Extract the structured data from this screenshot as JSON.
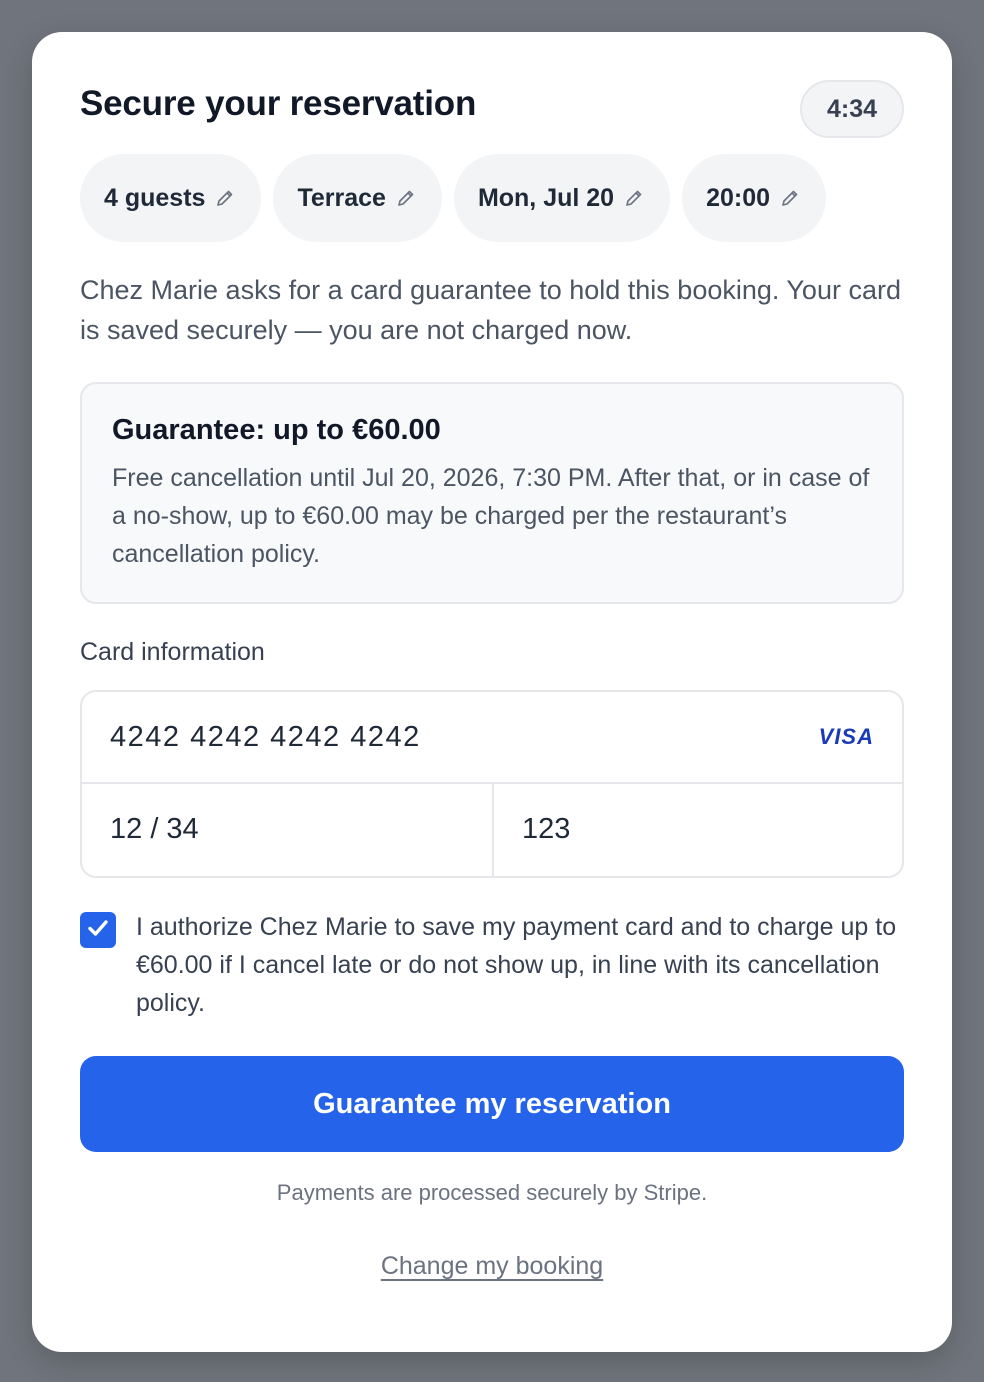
{
  "header": {
    "title": "Secure your reservation",
    "timer": "4:34"
  },
  "chips": [
    {
      "label": "4 guests",
      "icon": "pencil-icon"
    },
    {
      "label": "Terrace",
      "icon": "pencil-icon"
    },
    {
      "label": "Mon, Jul 20",
      "icon": "pencil-icon"
    },
    {
      "label": "20:00",
      "icon": "pencil-icon"
    }
  ],
  "intro": "Chez Marie asks for a card guarantee to hold this booking. Your card is saved securely — you are not charged now.",
  "guarantee": {
    "title": "Guarantee: up to €60.00",
    "text": "Free cancellation until Jul 20, 2026, 7:30 PM. After that, or in case of a no-show, up to €60.00 may be charged per the restaurant’s cancellation policy."
  },
  "card": {
    "label": "Card information",
    "number": "4242 4242 4242 4242",
    "brand": "VISA",
    "expiry": "12 / 34",
    "cvc": "123"
  },
  "consent": {
    "checked": true,
    "text": "I authorize Chez Marie to save my payment card and to charge up to €60.00 if I cancel late or do not show up, in line with its cancellation policy."
  },
  "actions": {
    "primary_label": "Guarantee my reservation",
    "stripe_note": "Payments are processed securely by Stripe.",
    "change_link": "Change my booking"
  },
  "colors": {
    "accent": "#2563eb",
    "backdrop": "#70747c",
    "visa": "#1a3ab8"
  }
}
